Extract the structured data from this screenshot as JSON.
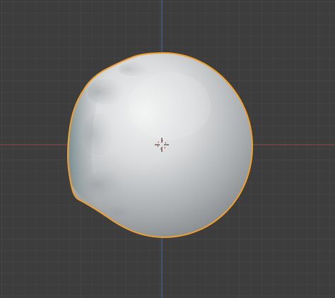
{
  "viewport": {
    "view": "3d-viewport",
    "background_color": "#3d3d3d",
    "grid": {
      "minor_color": "#474747",
      "major_color": "#4f4f4f",
      "x_axis_color": "#8a4a4a",
      "y_axis_color": "#4a6a9e"
    },
    "object": {
      "type": "sculpted-sphere",
      "selected": true,
      "outline_color": "#f0a030",
      "surface_color": "#c8cccd"
    },
    "cursor_3d": {
      "visible": true,
      "icon": "crosshair-icon"
    }
  }
}
